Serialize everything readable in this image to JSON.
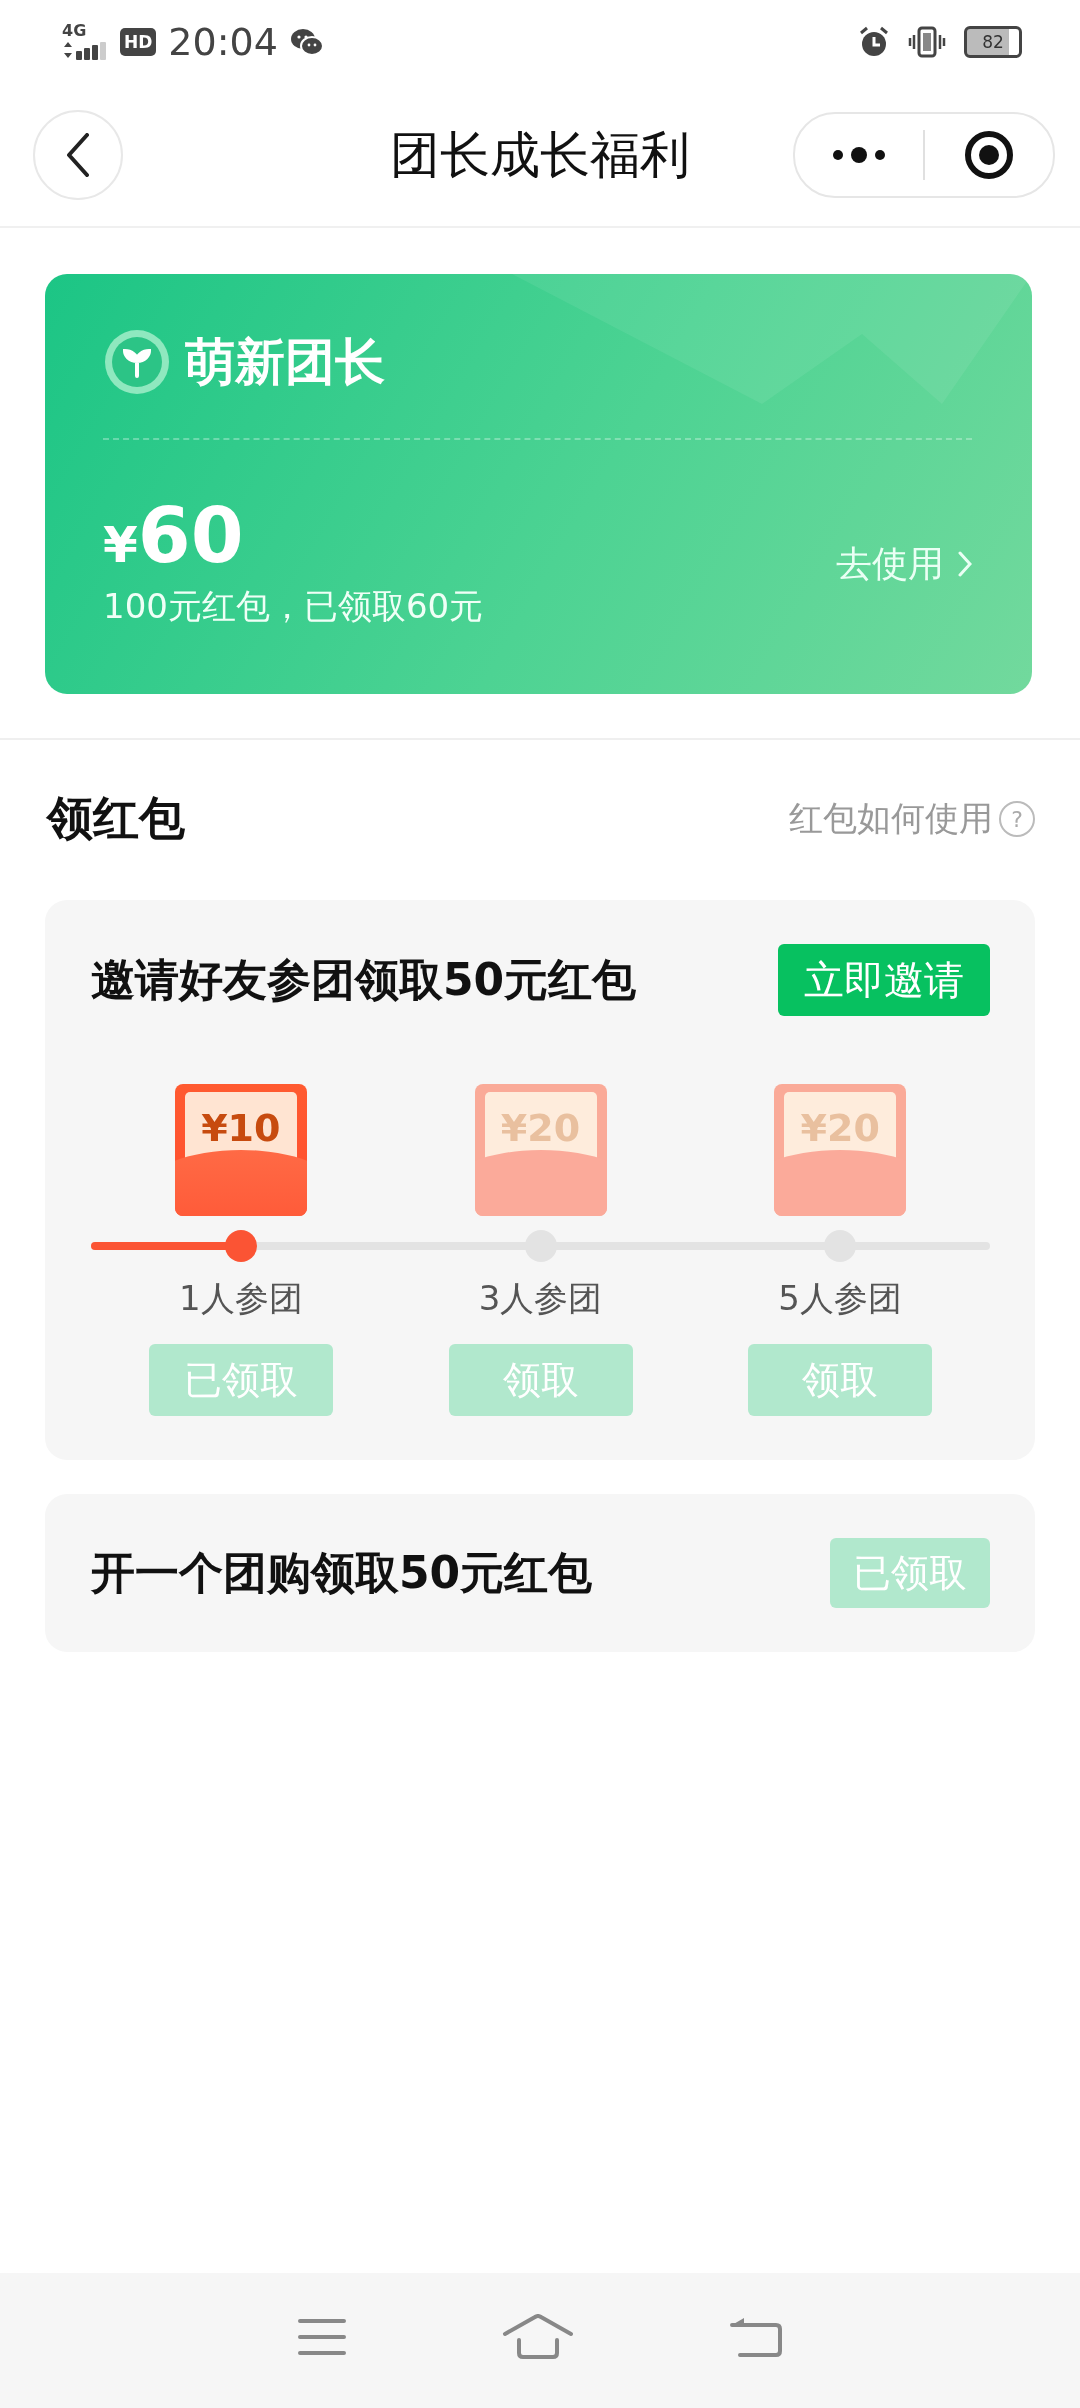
{
  "status_bar": {
    "network": "4G",
    "hd": "HD",
    "time": "20:04",
    "battery": "82"
  },
  "header": {
    "title": "团长成长福利"
  },
  "level_card": {
    "level_name": "萌新团长",
    "currency": "¥",
    "amount": "60",
    "summary": "100元红包，已领取60元",
    "action": "去使用"
  },
  "section": {
    "title": "领红包",
    "help": "红包如何使用",
    "help_icon": "?"
  },
  "invite_task": {
    "title": "邀请好友参团领取50元红包",
    "button": "立即邀请",
    "progress": {
      "level": 0.17
    },
    "tiers": [
      {
        "amount": "¥10",
        "label": "1人参团",
        "button": "已领取",
        "reached": true,
        "disabled": true
      },
      {
        "amount": "¥20",
        "label": "3人参团",
        "button": "领取",
        "reached": false,
        "disabled": true
      },
      {
        "amount": "¥20",
        "label": "5人参团",
        "button": "领取",
        "reached": false,
        "disabled": true
      }
    ]
  },
  "group_task": {
    "title": "开一个团购领取50元红包",
    "button": "已领取",
    "disabled": true
  }
}
